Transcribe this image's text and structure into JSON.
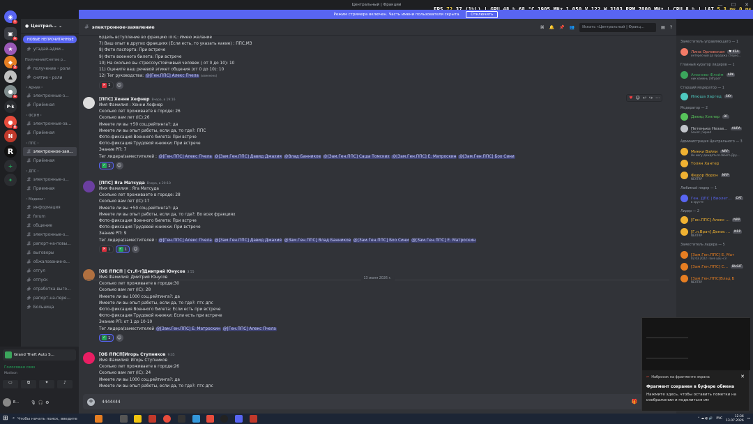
{
  "window": {
    "title": "Центральный | Фракции",
    "minimize": "—",
    "maximize": "☐",
    "close": "✕"
  },
  "overlay": {
    "fps_label": "FPS",
    "fps": "72",
    "fps_low": "37 (1%L)",
    "gpu_label": "GPU",
    "gpu": "48 % 68 °C 1905 MHz 1.050 V 122 W 3103 RPM 7000 MHz",
    "cpu_label": "CPU",
    "cpu": "8 %",
    "lat_label": "LAT",
    "lat": "5.3 ms 0 ms"
  },
  "streamer": {
    "text": "Режим стримера включен. Часть имени пользователя скрыта.",
    "button": "Отключить"
  },
  "server": {
    "name": "Централ...",
    "menu_icon": "chevron-down-icon",
    "unread_banner": "НОВЫЕ НЕПРОЧИТАННЫЕ",
    "pinned_hint": "угадай-адми..."
  },
  "channel_list": [
    {
      "type": "cat",
      "label": "Получение/Снятие р..."
    },
    {
      "type": "ch",
      "label": "получение・роли"
    },
    {
      "type": "ch",
      "label": "снятие・роли"
    },
    {
      "type": "cat",
      "label": "・Армия・"
    },
    {
      "type": "ch",
      "label": "электронные-з..."
    },
    {
      "type": "ch",
      "label": "Приёмная"
    },
    {
      "type": "cat",
      "label": "・ФСИН・"
    },
    {
      "type": "ch",
      "label": "электронные-за..."
    },
    {
      "type": "ch",
      "label": "Приёмная"
    },
    {
      "type": "cat",
      "label": "・ППС・"
    },
    {
      "type": "sel",
      "label": "электронное-зая..."
    },
    {
      "type": "ch",
      "label": "Приёмная"
    },
    {
      "type": "cat",
      "label": "・ДПС・"
    },
    {
      "type": "ch",
      "label": "электронные-з..."
    },
    {
      "type": "ch",
      "label": "Приемная"
    },
    {
      "type": "cat",
      "label": "・Медики・"
    },
    {
      "type": "ch",
      "label": "информация"
    },
    {
      "type": "ch",
      "label": "forum"
    },
    {
      "type": "ch",
      "label": "общение"
    },
    {
      "type": "ch",
      "label": "электронные-з..."
    },
    {
      "type": "ch",
      "label": "рапорт-на-повы..."
    },
    {
      "type": "ch",
      "label": "выговоры"
    },
    {
      "type": "ch",
      "label": "обжалование-в..."
    },
    {
      "type": "ch",
      "label": "отгул"
    },
    {
      "type": "ch",
      "label": "отпуск"
    },
    {
      "type": "ch",
      "label": "отработка-выго..."
    },
    {
      "type": "ch",
      "label": "рапорт-на-пере..."
    },
    {
      "type": "ch",
      "label": "Больница"
    }
  ],
  "voice": {
    "activity": "Grand Theft Auto S...",
    "status": "Голосовая связ",
    "channel": "Madison",
    "user_name": "E...",
    "user_sub": "..."
  },
  "header": {
    "channel": "электронное-заявление",
    "search_placeholder": "Искать «Центральный | Фракц..."
  },
  "messages": [
    {
      "author": "",
      "time": "",
      "lines": [
        "6)Цель вступление во фракцию ППС: Имею желание",
        "7) Ваш опыт в других фракциях (Если есть, то указать какие) : ППС,МЗ",
        "8) Фото паспорта: При встрече",
        "9) Фото военного билета: При встрече",
        "10) На сколько вы стрессоустойчивый человек ( от 0 до 10): 10",
        "11) Оцените ваш речевой этикет общения (от 0 до 10): 10"
      ],
      "tail_text": "12) Тег руководства: ",
      "mentions": [
        "@[Ген.ППС] Алекс Пчела"
      ],
      "edited": "(изменено)",
      "reactions": [
        {
          "emoji": "cross",
          "count": "1"
        }
      ]
    },
    {
      "author": "[ППС] Хенни Хефнер",
      "time": "Вчера, в 19:16",
      "lines": [
        "Имя Фамилия : Хенни Хефнер",
        "Сколько лет проживаете в городе: 26",
        "Сколько вам лет (IC):26",
        "Имеете ли вы +50 соц.рейтинга?: да",
        "Имеете ли вы опыт работы, если да, то где?: ППС",
        "Фото-фиксация Военного билета: При встрче",
        "Фото-фиксация Трудовой книжки: При встрече",
        "Знание РП: 7"
      ],
      "tail_text": "Тег лидера/заместителей : ",
      "mentions": [
        "@[Ген.ППС] Алекс Пчела",
        "@[Зам.Ген.ППС] Давид Джахия",
        "@Влад Банников",
        "@[Зам.Ген.ППС] Саша Томских",
        "@[Зам.Ген.ППС] Е. Матроскин",
        "@[Зам.Ген.ППС] Боо Сини"
      ],
      "reactions": [
        {
          "emoji": "check",
          "count": "1"
        }
      ]
    },
    {
      "author": "[ППС] Яга Матсуда",
      "time": "Вчера, в 20:10",
      "lines": [
        "Имя Фамилия : Яга Матсуда",
        "Сколько лет проживаете в городе: 28",
        "Сколько вам лет (IC):17",
        "Имеете ли вы +50 соц.рейтинга?: да",
        "Имеете ли вы опыт работы, если да, то где?: Во всех фракциях",
        "Фото-фиксация Военного билета: При встрче",
        "Фото-фиксация Трудовой книжки: При встрече",
        "Знание РП: 9"
      ],
      "tail_text": "Тег лидера/заместителей : ",
      "mentions": [
        "@[Ген.ППС] Алекс Пчела",
        "@[Зам.Ген.ППС] Давид Джахия",
        "@Зам.Ген.ППС] Влад Банников",
        "@[Зам.Ген.ППС] Боо Сини",
        "@[Зам.Ген.ППС] Е. Матроскин"
      ],
      "reactions": [
        {
          "emoji": "cross",
          "count": "1"
        },
        {
          "emoji": "check",
          "count": "1"
        }
      ]
    },
    {
      "author": "[ОБ ППСП | Ст.Л-т]Дмитрий Юнусов",
      "time": "3:55",
      "lines": [
        "Имя Фамилия: Дмитрий Юнусов",
        "Сколько лет проживаете в городе:30",
        "Сколько вам лет (IC): 28",
        "Имеете ли вы 1000 соц.рейтинга?: да",
        "Имеете ли вы опыт работы, если да, то где?:   птс дпс",
        "Фото-фиксация Военного билета: Если есть при встрече",
        "Фото-фиксация Трудовой книжки: Если есть при встрече",
        "Знание РП: от 1 до 10-10"
      ],
      "tail_text": "Тег лидера/заместителей ",
      "mentions": [
        "@[Зам.Ген.ППС] Е. Матроскин",
        "@[Ген.ППС] Алекс Пчела"
      ],
      "reactions": [
        {
          "emoji": "check",
          "count": "1"
        }
      ]
    },
    {
      "author": "[ОБ ППСП]Игорь Ступников",
      "time": "9:35",
      "lines": [
        "Имя Фамилия: Игорь Ступников",
        "Сколько лет проживаете в городе:26",
        "Сколько вам лет (IC): 24",
        "Имеете ли вы 1000 соц.рейтинга?: да",
        "Имеете ли вы опыт работы, если да, то где?:   птс дпс"
      ],
      "tail_text": "",
      "mentions": [],
      "reactions": []
    }
  ],
  "date_divider": "13 июля 2026 г.",
  "composer": {
    "value": "4444444"
  },
  "member_groups": [
    {
      "role": "Заместитель управляющего — 1",
      "members": [
        {
          "name": "Лина Орловская",
          "tag": "♥ KSA",
          "sub": "интересный да продажа стерео...",
          "color": "#f47b67"
        }
      ]
    },
    {
      "role": "Главный куратор лидеров — 1",
      "members": [
        {
          "name": "Аманеви Флэйм",
          "tag": "APK",
          "sub": "ник камень | Играет",
          "color": "#3ba55c"
        }
      ]
    },
    {
      "role": "Старший модератор — 1",
      "members": [
        {
          "name": "Илюша Харгед",
          "tag": "SKY",
          "sub": "",
          "color": "#4ec9c0"
        }
      ]
    },
    {
      "role": "Модератор — 2",
      "members": [
        {
          "name": "Дэвид Хэллер",
          "tag": "BF",
          "sub": "",
          "color": "#57c35a"
        },
        {
          "name": "Петенька Незав...",
          "tag": "AURA",
          "sub": "Soviet | Squad",
          "color": "#c2c5cb"
        }
      ]
    },
    {
      "role": "Администрация Центрального — 3",
      "members": [
        {
          "name": "Микки Вэйли",
          "tag": "NRP",
          "sub": "Не могу дождаться своего Дру...",
          "color": "#f0b232"
        },
        {
          "name": "Толян Хантер",
          "tag": "",
          "sub": "",
          "color": "#f0b232"
        },
        {
          "name": "Федор Ворон",
          "tag": "NRP",
          "sub": "NEXTRP",
          "color": "#f0b232"
        }
      ]
    },
    {
      "role": "Любимый лидер — 1",
      "members": [
        {
          "name": "Ген. ДПС | Виолет...",
          "tag": "CAT",
          "sub": "в хрусте",
          "color": "#5865f2"
        }
      ]
    },
    {
      "role": "Лидер — 2",
      "members": [
        {
          "name": "[Ген.ППС] Алекс ...",
          "tag": "NRP",
          "sub": "",
          "color": "#f0b232"
        },
        {
          "name": "[Г.л.Врач] Денис ...",
          "tag": "NRP",
          "sub": "NEXTRP",
          "color": "#f0b232"
        }
      ]
    },
    {
      "role": "Заместитель лидера — 5",
      "members": [
        {
          "name": "[Зам.Ген.ППС] Е. Матрос...",
          "tag": "",
          "sub": "02.03.2022 i love you <3",
          "color": "#e67e22"
        },
        {
          "name": "[Зам.Ген.ППС] С...",
          "tag": "BUGIT",
          "sub": "",
          "color": "#e67e22"
        },
        {
          "name": "[Зам.Ген.ППС]Влад Бан...",
          "tag": "",
          "sub": "NEXTRP",
          "color": "#e67e22"
        }
      ]
    }
  ],
  "toast": {
    "app": "Набросок на фрагменте экрана",
    "title": "Фрагмент сохранен в буфере обмена",
    "body": "Нажмите здесь, чтобы оставить пометки на изображении и поделиться им"
  },
  "taskbar": {
    "search_placeholder": "Чтобы начать поиск, введите",
    "lang": "РУС",
    "time": "12:36",
    "date": "13.07.2026"
  },
  "colors": {
    "accent": "#5865f2",
    "background": "#313338",
    "sidebar": "#2b2d31"
  }
}
